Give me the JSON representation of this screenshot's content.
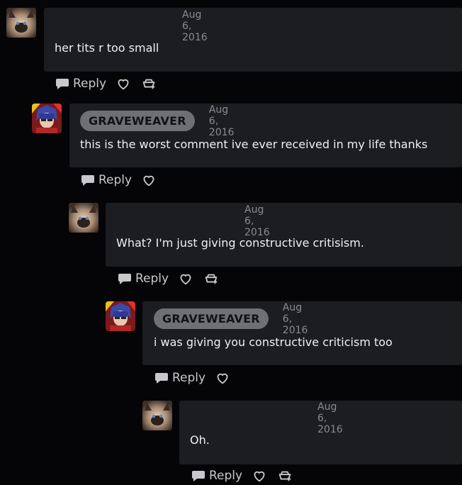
{
  "colors": {
    "background": "#050507",
    "bubble": "#1c1d21",
    "username_pill": "#6f7075",
    "date_text": "#8a8b90",
    "action_text": "#c8c9cd"
  },
  "icons": {
    "reply": "speech-bubble-icon",
    "like": "heart-icon",
    "tip": "gift-plus-icon"
  },
  "comments": [
    {
      "avatar": "siamese-cat-avatar",
      "username": "",
      "date": "Aug 6, 2016",
      "text": "her tits r too small",
      "reply_label": "Reply",
      "has_tip": true
    },
    {
      "avatar": "graveweaver-avatar",
      "username": "GRAVEWEAVER",
      "date": "Aug 6, 2016",
      "text": "this is the worst comment ive ever received in my life thanks",
      "reply_label": "Reply",
      "has_tip": false
    },
    {
      "avatar": "siamese-cat-avatar",
      "username": "",
      "date": "Aug 6, 2016",
      "text": "What? I'm just giving constructive critisism.",
      "reply_label": "Reply",
      "has_tip": true
    },
    {
      "avatar": "graveweaver-avatar",
      "username": "GRAVEWEAVER",
      "date": "Aug 6, 2016",
      "text": "i was giving you constructive criticism too",
      "reply_label": "Reply",
      "has_tip": false
    },
    {
      "avatar": "siamese-cat-avatar",
      "username": "",
      "date": "Aug 6, 2016",
      "text": "Oh.",
      "reply_label": "Reply",
      "has_tip": true
    }
  ]
}
